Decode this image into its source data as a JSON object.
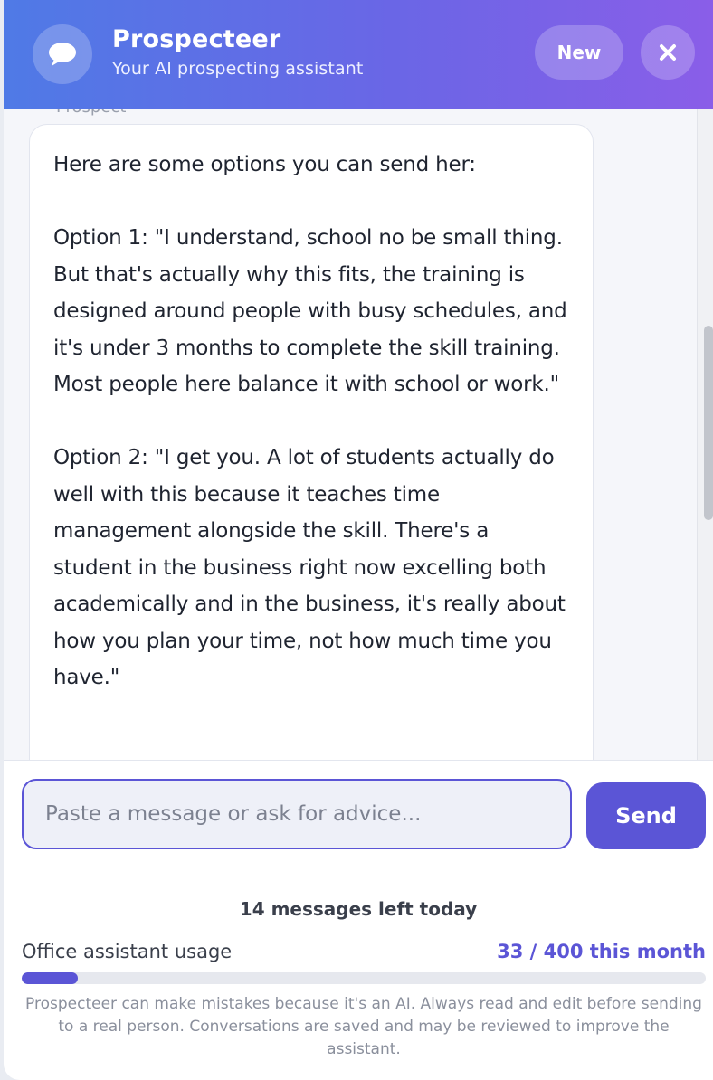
{
  "header": {
    "title": "Prospecteer",
    "subtitle": "Your AI prospecting assistant",
    "new_label": "New",
    "avatar_icon": "chat-bubble-icon",
    "close_icon": "close-icon"
  },
  "chat": {
    "message_text": "Here are some options you can send her:\n\nOption 1: \"I understand, school no be small thing. But that's actually why this fits, the training is designed around people with busy schedules, and it's under 3 months to complete the skill training. Most people here balance it with school or work.\"\n\nOption 2: \"I get you. A lot of students actually do well with this because it teaches time management alongside the skill. There's a student in the business right now excelling both academically and in the business, it's really about how you plan your time, not how much time you have.\""
  },
  "composer": {
    "placeholder": "Paste a message or ask for advice...",
    "value": "",
    "send_label": "Send"
  },
  "usage": {
    "messages_left": "14 messages left today",
    "label": "Office assistant usage",
    "count": "33 / 400 this month",
    "used": 33,
    "limit": 400
  },
  "disclaimer": "Prospecteer can make mistakes because it's an AI. Always read and edit before sending to a real person. Conversations are saved and may be reviewed to improve the assistant.",
  "colors": {
    "accent": "#5b55d6",
    "header_start": "#4f7ae6",
    "header_end": "#8a5ee8"
  }
}
